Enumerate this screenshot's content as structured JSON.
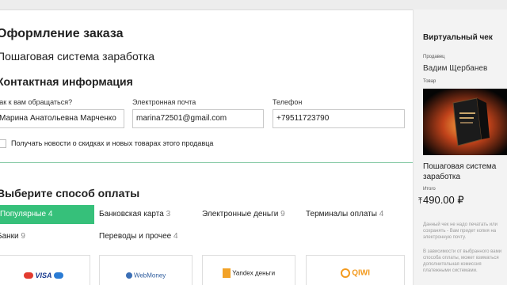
{
  "page": {
    "title": "Оформление заказа",
    "subtitle": "Пошаговая система заработка"
  },
  "contact": {
    "heading": "Контактная информация",
    "name_label": "Как к вам обращаться?",
    "name_value": "Марина Анатольевна Марченко",
    "email_label": "Электронная почта",
    "email_value": "marina72501@gmail.com",
    "phone_label": "Телефон",
    "phone_value": "+79511723790",
    "news_label": "Получать новости о скидках и новых товарах этого продавца",
    "news_checked": false
  },
  "payment": {
    "heading": "Выберите способ оплаты",
    "tabs": [
      {
        "label": "Популярные",
        "count": "4",
        "active": true
      },
      {
        "label": "Банковская карта",
        "count": "3",
        "active": false
      },
      {
        "label": "Электронные деньги",
        "count": "9",
        "active": false
      },
      {
        "label": "Терминалы оплаты",
        "count": "4",
        "active": false
      },
      {
        "label": "Банки",
        "count": "9",
        "active": false
      },
      {
        "label": "Переводы и прочее",
        "count": "4",
        "active": false
      }
    ],
    "methods": [
      {
        "label": "VISA",
        "icon": "card-logos-icon"
      },
      {
        "label": "WebMoney",
        "icon": "webmoney-icon"
      },
      {
        "label": "Yandex деньги",
        "icon": "yandex-money-icon"
      },
      {
        "label": "QIWI",
        "icon": "qiwi-icon"
      }
    ]
  },
  "receipt": {
    "title": "Виртуальный чек",
    "seller_label": "Продавец",
    "seller_name": "Вадим Щербанев",
    "product_label": "Товар",
    "product_name": "Пошаговая система заработка",
    "total_label": "Итого",
    "total_value": "490.00 ₽",
    "note1": "Данный чек не надо печатать или сохранять - Вам придет копия на электронную почту.",
    "note2": "В зависимости от выбранного вами способа оплаты, может взиматься дополнительная комиссия платежными системами."
  },
  "colors": {
    "accent_green": "#36c07a",
    "divider": "#7fc6a0"
  }
}
